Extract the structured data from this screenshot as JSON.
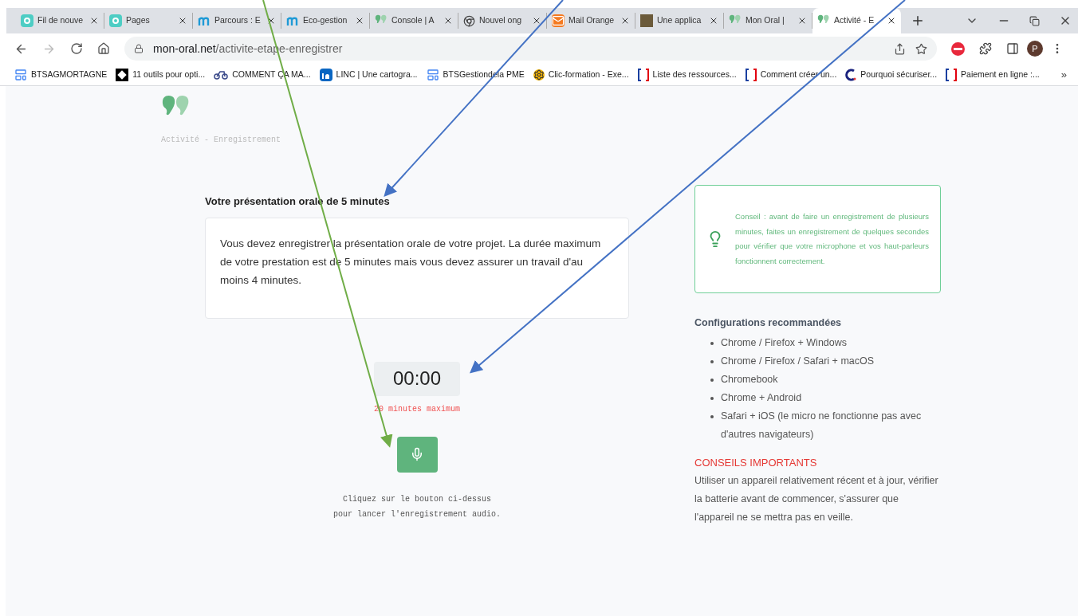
{
  "tabs": [
    {
      "kind": "e",
      "title": "Fil de nouve",
      "selected": false
    },
    {
      "kind": "e",
      "title": "Pages",
      "selected": false
    },
    {
      "kind": "m",
      "title": "Parcours : E",
      "selected": false
    },
    {
      "kind": "m",
      "title": "Eco-gestion",
      "selected": false
    },
    {
      "kind": "oral",
      "title": "Console | A",
      "selected": false
    },
    {
      "kind": "chrome",
      "title": "Nouvel ong",
      "selected": false
    },
    {
      "kind": "mail",
      "title": "Mail Orange",
      "selected": false
    },
    {
      "kind": "photo",
      "title": "Une applica",
      "selected": false
    },
    {
      "kind": "oral",
      "title": "Mon Oral |",
      "selected": false
    },
    {
      "kind": "oral",
      "title": "Activité - E",
      "selected": true
    }
  ],
  "address": {
    "host": "mon-oral.net",
    "path": "/activite-etape-enregistrer"
  },
  "profile_initial": "P",
  "bookmarks": [
    {
      "kind": "doc",
      "label": "BTSAGMORTAGNE"
    },
    {
      "kind": "star",
      "label": "11 outils pour opti..."
    },
    {
      "kind": "bike",
      "label": "COMMENT ÇA MA..."
    },
    {
      "kind": "in",
      "label": "LINC | Une cartogra..."
    },
    {
      "kind": "doc",
      "label": "BTSGestiondela PME"
    },
    {
      "kind": "gear",
      "label": "Clic-formation - Exe..."
    },
    {
      "kind": "flag",
      "label": "Liste des ressources..."
    },
    {
      "kind": "flag",
      "label": "Comment créer un..."
    },
    {
      "kind": "c",
      "label": "Pourquoi sécuriser..."
    },
    {
      "kind": "flag",
      "label": "Paiement en ligne :..."
    }
  ],
  "bookmarks_more": "»",
  "page": {
    "subtitle": "Activité - Enregistrement",
    "heading": "Votre présentation orale de 5 minutes",
    "instructions": "Vous devez enregistrer la présentation orale de votre projet. La durée maximum de votre prestation est de 5 minutes mais vous devez assurer un travail d'au moins 4 minutes.",
    "timer": "00:00",
    "limit": "20 minutes maximum",
    "caption": [
      "Cliquez sur le bouton ci-dessus",
      "pour lancer l'enregistrement audio."
    ],
    "tip": "Conseil : avant de faire un enregistrement de plusieurs minutes, faites un enregistrement de quelques secondes pour vérifier que votre microphone et vos haut-parleurs fonctionnent correctement.",
    "config_title": "Configurations recommandées",
    "configs": [
      "Chrome / Firefox + Windows",
      "Chrome / Firefox / Safari + macOS",
      "Chromebook",
      "Chrome + Android",
      "Safari + iOS (le micro ne fonctionne pas avec d'autres navigateurs)"
    ],
    "important_title": "CONSEILS IMPORTANTS",
    "important_text": "Utiliser un appareil relativement récent et à jour, vérifier la batterie avant de commencer, s'assurer que l'appareil ne se mettra pas en veille."
  }
}
